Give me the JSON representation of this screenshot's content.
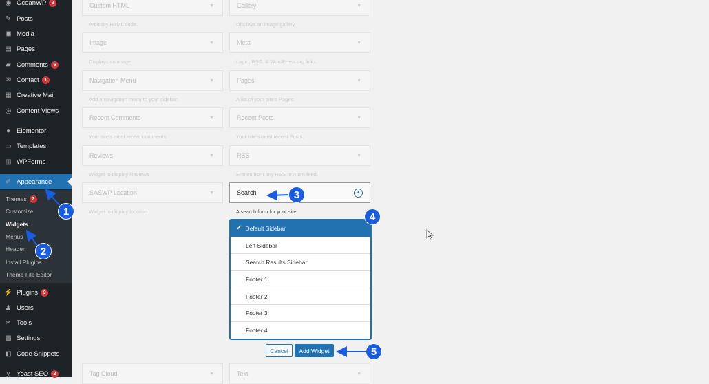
{
  "sidebar": {
    "items": [
      {
        "label": "OceanWP",
        "icon": "oceanwp-icon",
        "badge": "2"
      },
      {
        "label": "Posts",
        "icon": "pin-icon"
      },
      {
        "label": "Media",
        "icon": "media-icon"
      },
      {
        "label": "Pages",
        "icon": "pages-icon"
      },
      {
        "label": "Comments",
        "icon": "comment-icon",
        "badge": "6"
      },
      {
        "label": "Contact",
        "icon": "mail-icon",
        "badge": "1"
      },
      {
        "label": "Creative Mail",
        "icon": "cm-icon"
      },
      {
        "label": "Content Views",
        "icon": "cv-icon"
      },
      {
        "label": "Elementor",
        "icon": "elementor-icon"
      },
      {
        "label": "Templates",
        "icon": "folder-icon"
      },
      {
        "label": "WPForms",
        "icon": "wpforms-icon"
      },
      {
        "label": "Appearance",
        "icon": "brush-icon"
      },
      {
        "label": "Plugins",
        "icon": "plugin-icon",
        "badge": "9"
      },
      {
        "label": "Users",
        "icon": "user-icon"
      },
      {
        "label": "Tools",
        "icon": "wrench-icon"
      },
      {
        "label": "Settings",
        "icon": "settings-icon"
      },
      {
        "label": "Code Snippets",
        "icon": "code-icon"
      },
      {
        "label": "Yoast SEO",
        "icon": "yoast-icon",
        "badge": "2"
      }
    ],
    "submenu": [
      {
        "label": "Themes",
        "badge": "2"
      },
      {
        "label": "Customize"
      },
      {
        "label": "Widgets",
        "current": true
      },
      {
        "label": "Menus"
      },
      {
        "label": "Header"
      },
      {
        "label": "Install Plugins"
      },
      {
        "label": "Theme File Editor"
      }
    ]
  },
  "widgets": {
    "left": [
      {
        "title": "Custom HTML",
        "desc": "Arbitrary HTML code."
      },
      {
        "title": "Image",
        "desc": "Displays an image."
      },
      {
        "title": "Navigation Menu",
        "desc": "Add a navigation menu to your sidebar."
      },
      {
        "title": "Recent Comments",
        "desc": "Your site's most recent comments."
      },
      {
        "title": "Reviews",
        "desc": "Widget to display Reviews"
      },
      {
        "title": "SASWP Location",
        "desc": "Widget to display location"
      }
    ],
    "right": [
      {
        "title": "Gallery",
        "desc": "Displays an image gallery."
      },
      {
        "title": "Meta",
        "desc": "Login, RSS, & WordPress.org links."
      },
      {
        "title": "Pages",
        "desc": "A list of your site's Pages."
      },
      {
        "title": "Recent Posts",
        "desc": "Your site's most recent Posts."
      },
      {
        "title": "RSS",
        "desc": "Entries from any RSS or Atom feed."
      },
      {
        "title": "Search",
        "desc": "A search form for your site."
      }
    ],
    "bottom": [
      {
        "title": "Tag Cloud"
      },
      {
        "title": "Text"
      }
    ]
  },
  "sidebar_chooser": {
    "options": [
      "Default Sidebar",
      "Left Sidebar",
      "Search Results Sidebar",
      "Footer 1",
      "Footer 2",
      "Footer 3",
      "Footer 4"
    ],
    "selected": "Default Sidebar"
  },
  "buttons": {
    "cancel": "Cancel",
    "add_widget": "Add Widget"
  },
  "annotations": [
    "1",
    "2",
    "3",
    "4",
    "5"
  ],
  "colors": {
    "accent": "#2271b1",
    "annotation": "#1a5ce0",
    "badge": "#d63638"
  }
}
